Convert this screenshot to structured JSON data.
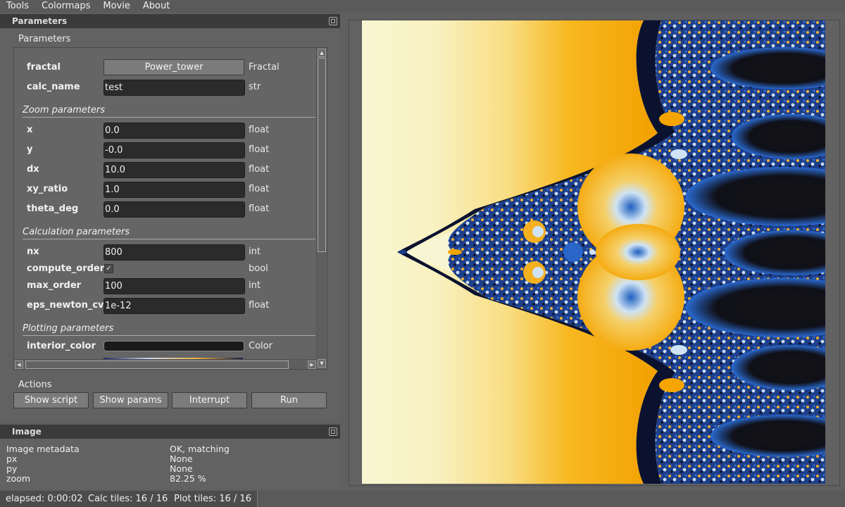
{
  "menu": [
    "Tools",
    "Colormaps",
    "Movie",
    "About"
  ],
  "params_dock": {
    "title": "Parameters",
    "group_title": "Parameters",
    "rows": {
      "fractal": {
        "label": "fractal",
        "value": "Power_tower",
        "type": "Fractal"
      },
      "calc_name": {
        "label": "calc_name",
        "value": "test",
        "type": "str"
      },
      "x": {
        "label": "x",
        "value": "0.0",
        "type": "float"
      },
      "y": {
        "label": "y",
        "value": "-0.0",
        "type": "float"
      },
      "dx": {
        "label": "dx",
        "value": "10.0",
        "type": "float"
      },
      "xy_ratio": {
        "label": "xy_ratio",
        "value": "1.0",
        "type": "float"
      },
      "theta_deg": {
        "label": "theta_deg",
        "value": "0.0",
        "type": "float"
      },
      "nx": {
        "label": "nx",
        "value": "800",
        "type": "int"
      },
      "compute_order": {
        "label": "compute_order",
        "value": "✓",
        "type": "bool"
      },
      "max_order": {
        "label": "max_order",
        "value": "100",
        "type": "int"
      },
      "eps_newton_cv": {
        "label": "eps_newton_cv",
        "value": "1e-12",
        "type": "float"
      },
      "interior_color": {
        "label": "interior_color",
        "type": "Color"
      }
    },
    "sections": {
      "zoom": "Zoom parameters",
      "calc": "Calculation parameters",
      "plot": "Plotting parameters"
    },
    "actions_title": "Actions",
    "actions": {
      "show_script": "Show script",
      "show_params": "Show params",
      "interrupt": "Interrupt",
      "run": "Run"
    }
  },
  "image_dock": {
    "title": "Image",
    "metadata": [
      {
        "key": "Image metadata",
        "value": "OK, matching"
      },
      {
        "key": "px",
        "value": "None"
      },
      {
        "key": "py",
        "value": "None"
      },
      {
        "key": "zoom",
        "value": "82.25 %"
      }
    ]
  },
  "status": {
    "elapsed": "elapsed: 0:00:02",
    "calc_tiles": "Calc tiles: 16 / 16",
    "plot_tiles": "Plot tiles: 16 / 16"
  },
  "colors": {
    "interior": "#1a1a1a",
    "fractal_cream": "#f8f6d2",
    "fractal_orange": "#f7a800",
    "fractal_blue": "#1f5fc0",
    "fractal_dark": "#0a0a14"
  }
}
